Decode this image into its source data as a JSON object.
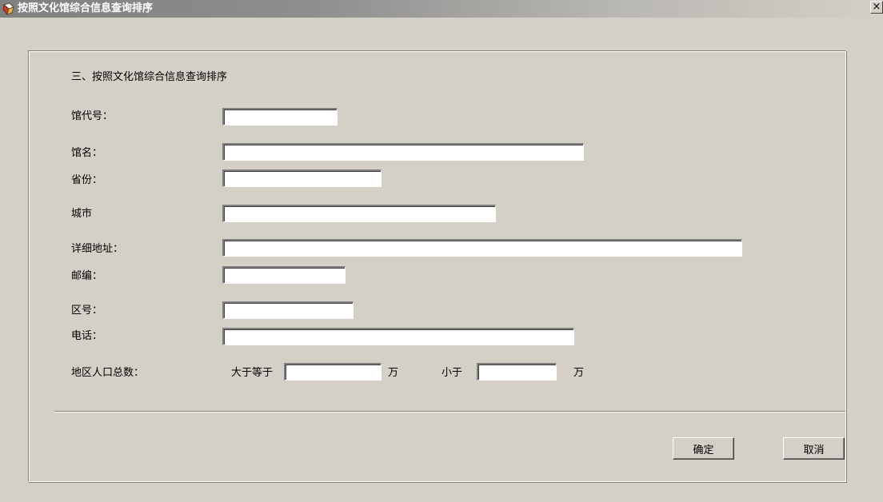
{
  "window": {
    "title": "按照文化馆综合信息查询排序",
    "close_glyph": "×"
  },
  "form": {
    "heading": "三、按照文化馆综合信息查询排序",
    "fields": {
      "hall_code": {
        "label": "馆代号：",
        "value": ""
      },
      "hall_name": {
        "label": "馆名：",
        "value": ""
      },
      "province": {
        "label": "省份：",
        "value": ""
      },
      "city": {
        "label": "城市",
        "value": ""
      },
      "address": {
        "label": "详细地址：",
        "value": ""
      },
      "postcode": {
        "label": "邮编：",
        "value": ""
      },
      "area_code": {
        "label": "区号：",
        "value": ""
      },
      "phone": {
        "label": "电话：",
        "value": ""
      }
    },
    "population": {
      "label": "地区人口总数：",
      "gte_label": "大于等于",
      "gte_value": "",
      "unit_1": "万",
      "lt_label": "小于",
      "lt_value": "",
      "unit_2": "万"
    }
  },
  "buttons": {
    "ok": "确定",
    "cancel": "取消"
  }
}
